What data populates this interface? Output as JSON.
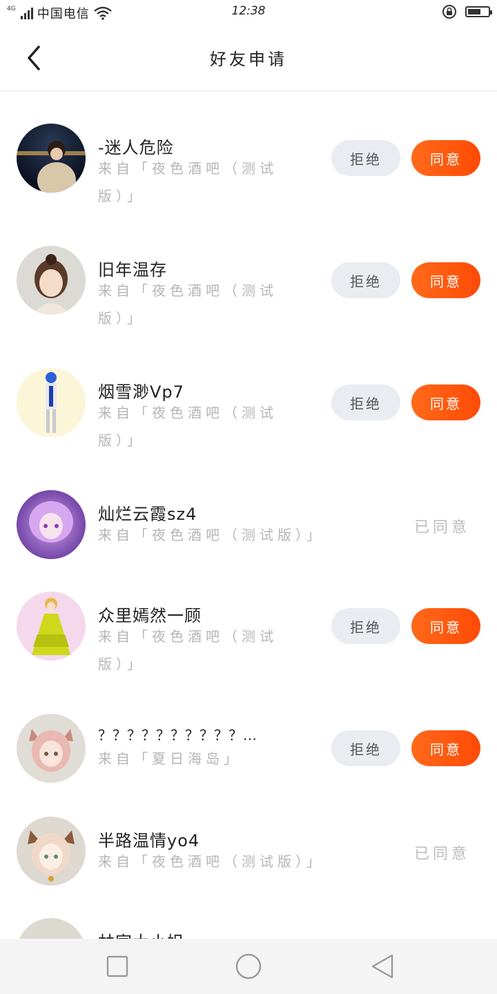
{
  "status_bar": {
    "network": "4G",
    "carrier": "中国电信",
    "time": "12:38",
    "battery_level": 0.65
  },
  "header": {
    "title": "好友申请",
    "back_icon": "chevron-left-icon"
  },
  "labels": {
    "reject": "拒绝",
    "accept": "同意",
    "accepted": "已同意"
  },
  "requests": [
    {
      "name": "-迷人危险",
      "source_line1": "来自「夜色酒吧（测试",
      "source_line2": "版）」",
      "status": "pending",
      "avatar": "photo-avatar"
    },
    {
      "name": "旧年温存",
      "source_line1": "来自「夜色酒吧（测试",
      "source_line2": "版）」",
      "status": "pending",
      "avatar": "anime-girl-avatar"
    },
    {
      "name": "烟雪渺Vp7",
      "source_line1": "来自「夜色酒吧（测试",
      "source_line2": "版）」",
      "status": "pending",
      "avatar": "anime-boy-avatar"
    },
    {
      "name": "灿烂云霞sz4",
      "source_line1": "来自「夜色酒吧（测试版）」",
      "source_line2": "",
      "status": "accepted",
      "avatar": "anime-purple-avatar"
    },
    {
      "name": "众里嫣然一顾",
      "source_line1": "来自「夜色酒吧（测试",
      "source_line2": "版）」",
      "status": "pending",
      "avatar": "anime-dress-avatar"
    },
    {
      "name": "？？？？？？？？？？…",
      "source_line1": "来自「夏日海岛」",
      "source_line2": "",
      "status": "pending",
      "avatar": "anime-cat-girl-avatar"
    },
    {
      "name": "半路温情yo4",
      "source_line1": "来自「夜色酒吧（测试版）」",
      "source_line2": "",
      "status": "accepted",
      "avatar": "anime-cat-girl-avatar-2"
    },
    {
      "name": "林家大小姐",
      "source_line1": "",
      "source_line2": "",
      "status": "partial",
      "avatar": "default-avatar"
    }
  ],
  "nav_bar": {
    "recents_icon": "square-icon",
    "home_icon": "circle-icon",
    "back_icon": "triangle-back-icon"
  },
  "colors": {
    "accent": "#ff5a10",
    "reject_bg": "#e9ecf1",
    "muted_text": "#b5b5b5"
  }
}
